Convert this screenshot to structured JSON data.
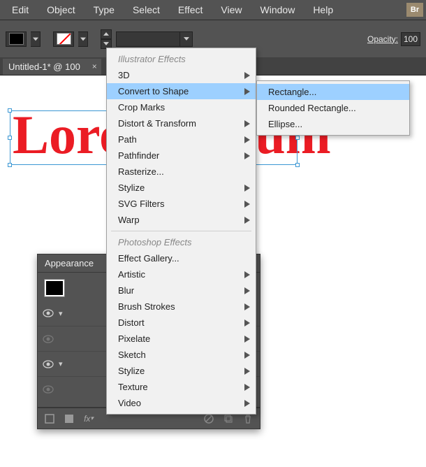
{
  "menubar": {
    "items": [
      "Edit",
      "Object",
      "Type",
      "Select",
      "Effect",
      "View",
      "Window",
      "Help"
    ],
    "bridge": "Br"
  },
  "toolbar": {
    "opacity_label": "Opacity:",
    "opacity_value": "100"
  },
  "doc": {
    "tab_title": "Untitled-1* @ 100"
  },
  "canvas": {
    "text_value": "Lorem Ipsum"
  },
  "panel": {
    "title": "Appearance"
  },
  "effect_menu": {
    "header1": "Illustrator Effects",
    "items1": [
      {
        "label": "3D",
        "arrow": true
      },
      {
        "label": "Convert to Shape",
        "arrow": true,
        "highlight": true
      },
      {
        "label": "Crop Marks",
        "arrow": false
      },
      {
        "label": "Distort & Transform",
        "arrow": true
      },
      {
        "label": "Path",
        "arrow": true
      },
      {
        "label": "Pathfinder",
        "arrow": true
      },
      {
        "label": "Rasterize...",
        "arrow": false
      },
      {
        "label": "Stylize",
        "arrow": true
      },
      {
        "label": "SVG Filters",
        "arrow": true
      },
      {
        "label": "Warp",
        "arrow": true
      }
    ],
    "header2": "Photoshop Effects",
    "items2": [
      {
        "label": "Effect Gallery...",
        "arrow": false
      },
      {
        "label": "Artistic",
        "arrow": true
      },
      {
        "label": "Blur",
        "arrow": true
      },
      {
        "label": "Brush Strokes",
        "arrow": true
      },
      {
        "label": "Distort",
        "arrow": true
      },
      {
        "label": "Pixelate",
        "arrow": true
      },
      {
        "label": "Sketch",
        "arrow": true
      },
      {
        "label": "Stylize",
        "arrow": true
      },
      {
        "label": "Texture",
        "arrow": true
      },
      {
        "label": "Video",
        "arrow": true
      }
    ]
  },
  "submenu": {
    "items": [
      {
        "label": "Rectangle...",
        "highlight": true
      },
      {
        "label": "Rounded Rectangle...",
        "highlight": false
      },
      {
        "label": "Ellipse...",
        "highlight": false
      }
    ]
  }
}
